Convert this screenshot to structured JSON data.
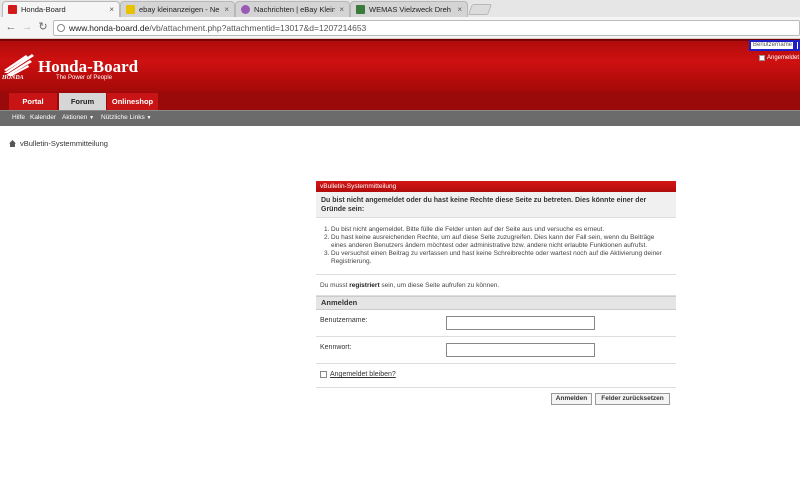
{
  "browser": {
    "tabs": [
      {
        "label": "Honda-Board",
        "active": true
      },
      {
        "label": "ebay kleinanzeigen - Ne",
        "active": false
      },
      {
        "label": "Nachrichten | eBay Klein",
        "active": false
      },
      {
        "label": "WEMAS Vielzweck Dreh",
        "active": false
      }
    ],
    "url_domain": "www.honda-board.de",
    "url_path": "/vb/attachment.php?attachmentid=13017&d=1207214653"
  },
  "header": {
    "brand_small": "HONDA",
    "title": "Honda-Board",
    "tagline": "The Power of People",
    "username_placeholder": "Benutzername",
    "remember_label": "Angemeldet"
  },
  "nav": {
    "tabs": [
      "Portal",
      "Forum",
      "Onlineshop"
    ],
    "sub": [
      "Hilfe",
      "Kalender",
      "Aktionen",
      "Nützliche Links"
    ]
  },
  "breadcrumb": {
    "label": "vBulletin-Systemmitteilung"
  },
  "message": {
    "head": "vBulletin-Systemmitteilung",
    "title": "Du bist nicht angemeldet oder du hast keine Rechte diese Seite zu betreten. Dies könnte einer der Gründe sein:",
    "reasons": [
      "Du bist nicht angemeldet. Bitte fülle die Felder unten auf der Seite aus und versuche es erneut.",
      "Du hast keine ausreichenden Rechte, um auf diese Seite zuzugreifen. Dies kann der Fall sein, wenn du Beiträge eines anderen Benutzers ändern möchtest oder administrative bzw. andere nicht erlaubte Funktionen aufrufst.",
      "Du versuchst einen Beitrag zu verfassen und hast keine Schreibrechte oder wartest noch auf die Aktivierung deiner Registrierung."
    ],
    "note_before": "Du musst ",
    "note_bold": "registriert",
    "note_after": " sein, um diese Seite aufrufen zu können."
  },
  "login_form": {
    "section_title": "Anmelden",
    "username_label": "Benutzername:",
    "password_label": "Kennwort:",
    "remember_label": "Angemeldet bleiben?",
    "login_button": "Anmelden",
    "reset_button": "Felder zurücksetzen"
  },
  "colors": {
    "brand_red": "#c81414",
    "dark_red": "#9a0a0a",
    "subnav_gray": "#6b6b6b"
  }
}
